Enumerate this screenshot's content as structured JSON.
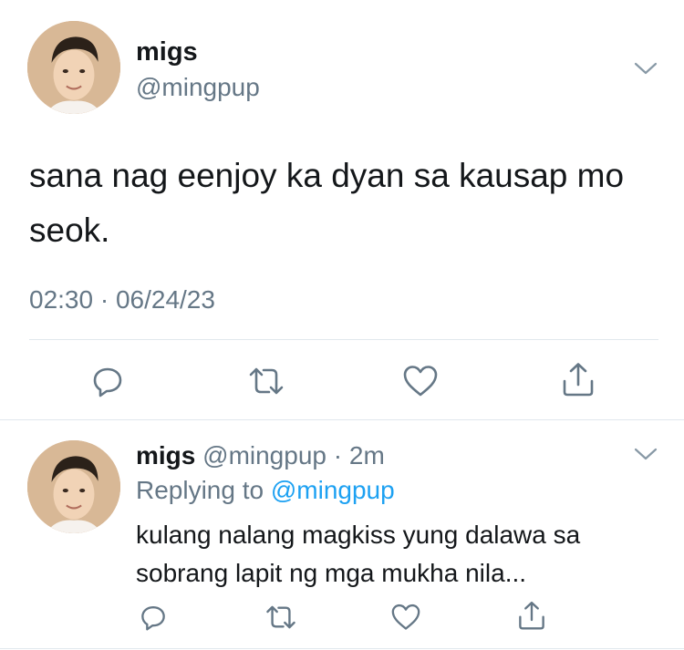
{
  "main_tweet": {
    "display_name": "migs",
    "handle": "@mingpup",
    "text": "sana nag eenjoy ka dyan sa kausap mo seok.",
    "timestamp": "02:30 · 06/24/23"
  },
  "reply": {
    "display_name": "migs",
    "handle": "@mingpup",
    "separator": " · ",
    "time_ago": "2m",
    "replying_prefix": "Replying to ",
    "replying_handle": "@mingpup",
    "text": "kulang nalang magkiss yung dalawa sa sobrang lapit ng mga mukha nila..."
  },
  "icons": {
    "more": "chevron-down-icon",
    "reply": "reply-bubble-icon",
    "retweet": "retweet-icon",
    "like": "heart-icon",
    "share": "share-icon"
  },
  "colors": {
    "text": "#14171a",
    "secondary": "#657786",
    "link": "#1da1f2",
    "divider": "#e1e8ed"
  }
}
